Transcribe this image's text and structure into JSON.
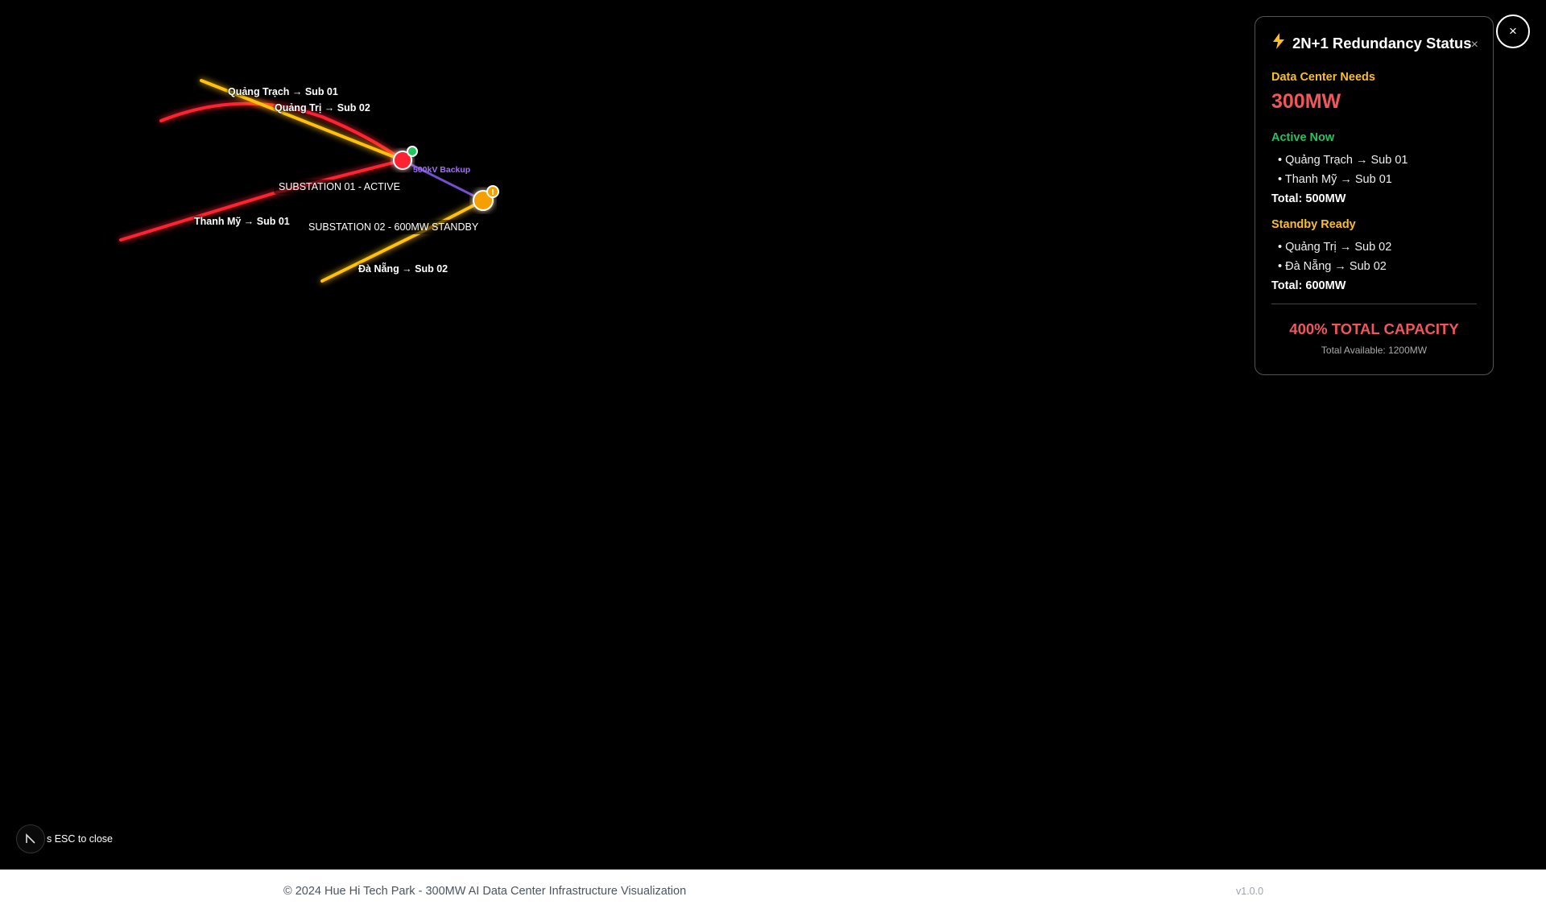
{
  "map": {
    "routes": [
      {
        "label": "Quảng Trạch → Sub 01",
        "color": "#ffc107"
      },
      {
        "label": "Quảng Trị → Sub 02",
        "color": "#ff3344"
      },
      {
        "label": "Thanh Mỹ → Sub 01",
        "color": "#ff3344"
      },
      {
        "label": "Đà Nẵng → Sub 02",
        "color": "#ffc107"
      }
    ],
    "substation_01_label": "SUBSTATION 01 - ACTIVE",
    "substation_02_label": "SUBSTATION 02 - 600MW STANDBY",
    "backup_link_label": "500kV Backup",
    "colors": {
      "active": "#ff2233",
      "standby": "#f5a000",
      "backup": "#8a5cf6",
      "ok": "#22c55e"
    }
  },
  "panel": {
    "icon": "lightning-icon",
    "title": "2N+1 Redundancy Status",
    "close_glyph": "×",
    "needs_label": "Data Center Needs",
    "needs_value": "300MW",
    "active_label": "Active Now",
    "active_routes": [
      "Quảng Trạch → Sub 01",
      "Thanh Mỹ → Sub 01"
    ],
    "active_total": "Total: 500MW",
    "standby_label": "Standby Ready",
    "standby_routes": [
      "Quảng Trị → Sub 02",
      "Đà Nẵng → Sub 02"
    ],
    "standby_total": "Total: 600MW",
    "capacity": "400% TOTAL CAPACITY",
    "available": "Total Available: 1200MW"
  },
  "close_button": "×",
  "esc_hint": "s ESC to close",
  "footer": {
    "copyright": "© 2024 Hue Hi Tech Park - 300MW AI Data Center Infrastructure Visualization",
    "version": "v1.0.0"
  }
}
